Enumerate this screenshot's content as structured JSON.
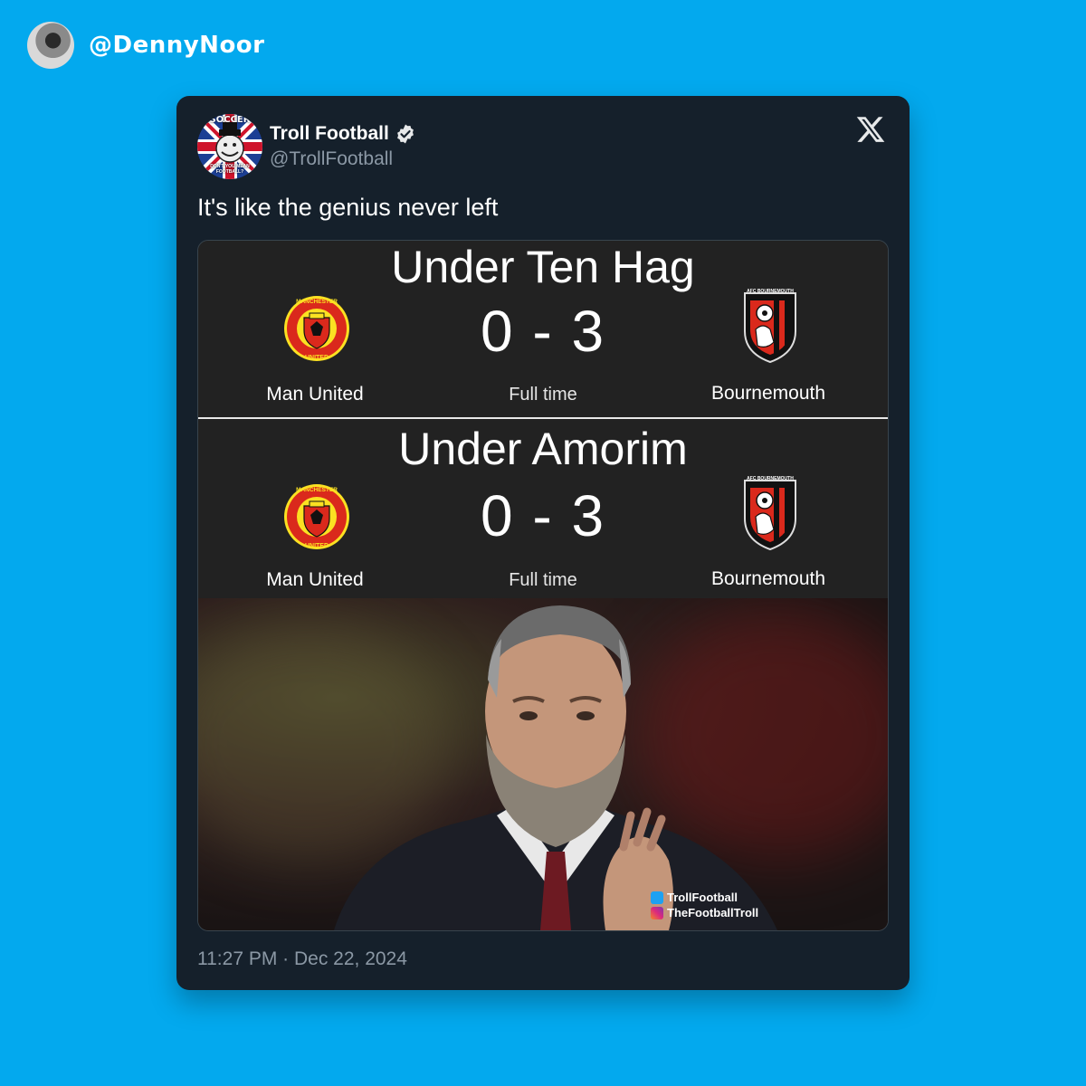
{
  "outer": {
    "handle": "@DennyNoor"
  },
  "tweet": {
    "display_name": "Troll Football",
    "handle": "@TrollFootball",
    "text": "It's like the genius never left",
    "timestamp": "11:27 PM · Dec 22, 2024"
  },
  "avatar_text": {
    "top": "SOCCER",
    "bottom": "DON'T YOU MEAN FOOTBALL?"
  },
  "media": {
    "panels": [
      {
        "title": "Under Ten Hag",
        "score": "0 - 3",
        "home": "Man United",
        "status": "Full time",
        "away": "Bournemouth"
      },
      {
        "title": "Under Amorim",
        "score": "0 - 3",
        "home": "Man United",
        "status": "Full time",
        "away": "Bournemouth"
      }
    ],
    "crest_text": {
      "home_top": "MANCHESTER",
      "home_bottom": "UNITED",
      "away_top": "AFC BOURNEMOUTH"
    },
    "watermark": {
      "twitter": "TrollFootball",
      "instagram": "TheFootballTroll"
    }
  },
  "colors": {
    "background": "#03a9ee",
    "card": "#15202b",
    "muted": "#8b98a5",
    "united_red": "#da291c",
    "united_gold": "#fbe122"
  },
  "icons": [
    "x-logo-icon",
    "verified-badge-icon",
    "twitter-icon",
    "instagram-icon"
  ]
}
